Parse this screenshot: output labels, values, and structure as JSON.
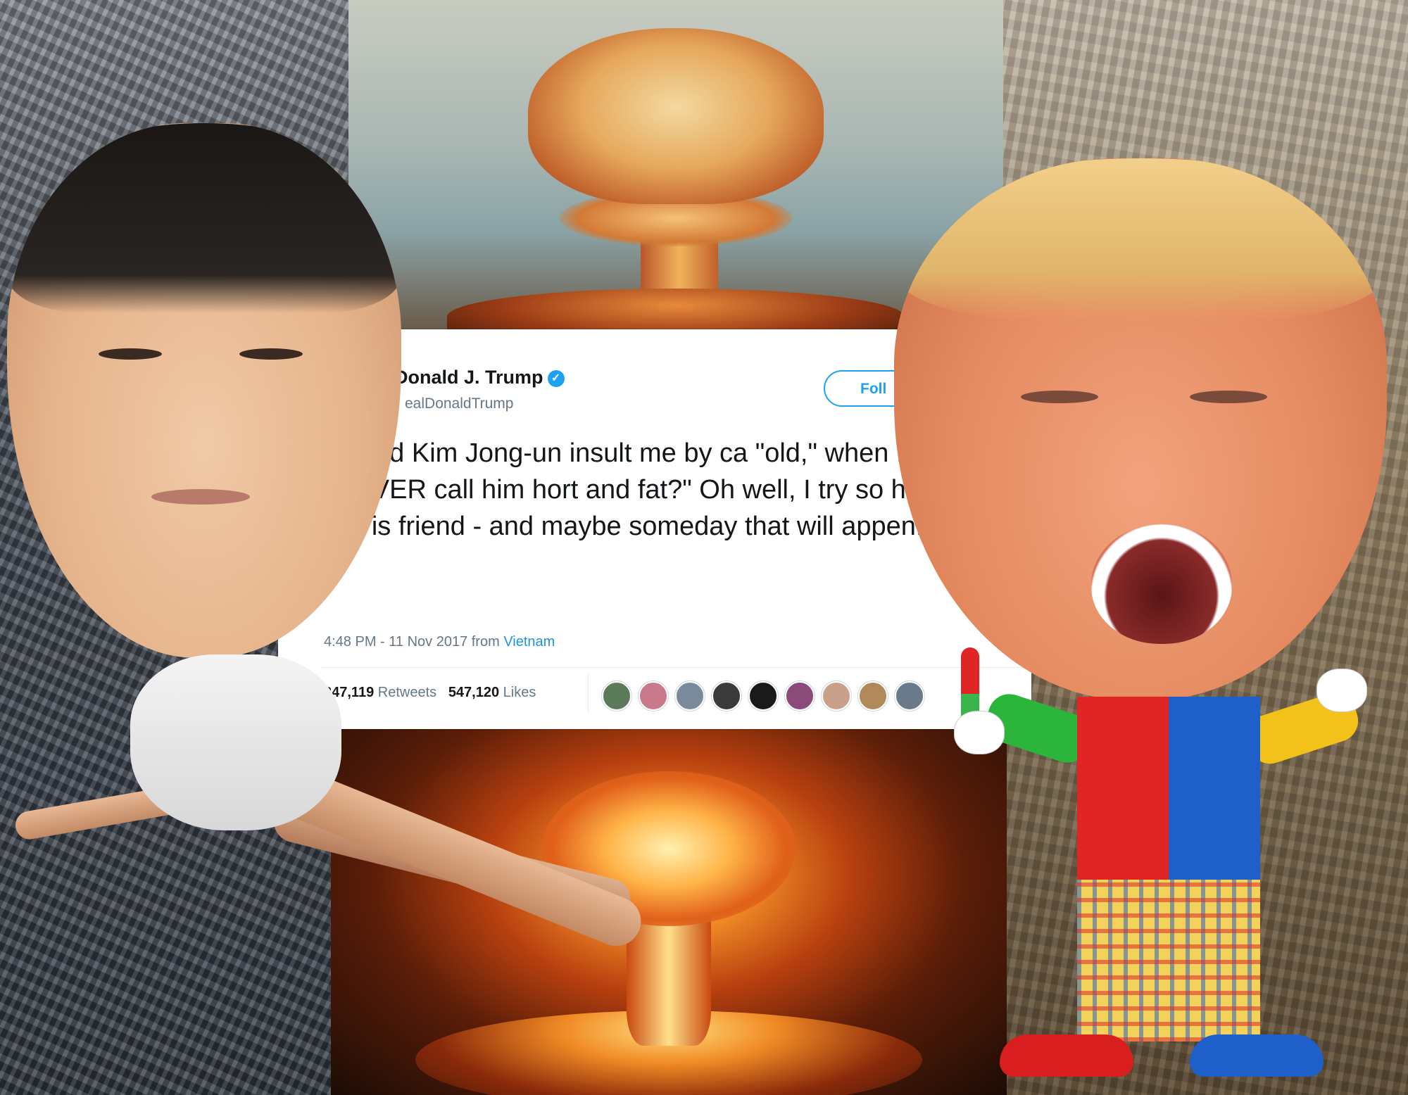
{
  "tweet": {
    "display_name": "Donald J. Trump",
    "handle": "ealDonaldTrump",
    "follow_label": "Foll",
    "text": "would Kim Jong-un insult me by ca \"old,\" when I would NEVER call him hort and fat?\" Oh well, I try so hard to be is friend - and maybe someday that will appen!",
    "timestamp": "4:48 PM - 11 Nov 2017 from",
    "location": "Vietnam",
    "retweets_count": "247,119",
    "retweets_label": "Retweets",
    "likes_count": "547,120",
    "likes_label": "Likes",
    "verified_icon": "verified-check-icon",
    "avatar_colors": [
      "#5a7a5a",
      "#c87a8a",
      "#7a8a9a",
      "#3a3a3a",
      "#1a1a1a",
      "#8a4a7a",
      "#c9a08a",
      "#b08a5a",
      "#6a7a8a"
    ]
  },
  "colors": {
    "twitter_blue": "#1da1f2",
    "link_blue": "#1b95e0"
  }
}
